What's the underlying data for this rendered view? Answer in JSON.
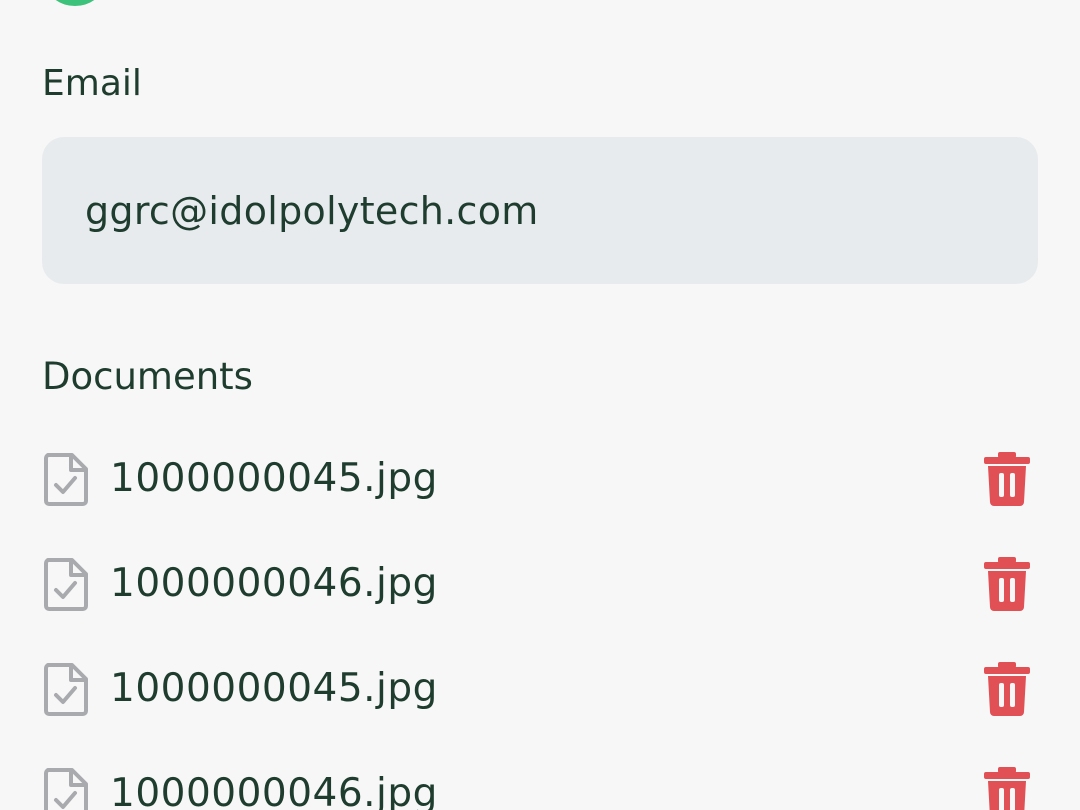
{
  "email": {
    "label": "Email",
    "value": "ggrc@idolpolytech.com"
  },
  "documents": {
    "label": "Documents",
    "items": [
      {
        "name": "1000000045.jpg",
        "icon": "file-check-icon",
        "action_icon": "trash-icon"
      },
      {
        "name": "1000000046.jpg",
        "icon": "file-check-icon",
        "action_icon": "trash-icon"
      },
      {
        "name": "1000000045.jpg",
        "icon": "file-check-icon",
        "action_icon": "trash-icon"
      },
      {
        "name": "1000000046.jpg",
        "icon": "file-check-icon",
        "action_icon": "trash-icon"
      }
    ]
  },
  "colors": {
    "background": "#f7f7f7",
    "field_background": "#e8ebee",
    "text": "#1f3d2f",
    "delete": "#e05055",
    "file_icon": "#a9aaae",
    "status_green": "#3cc27a"
  }
}
